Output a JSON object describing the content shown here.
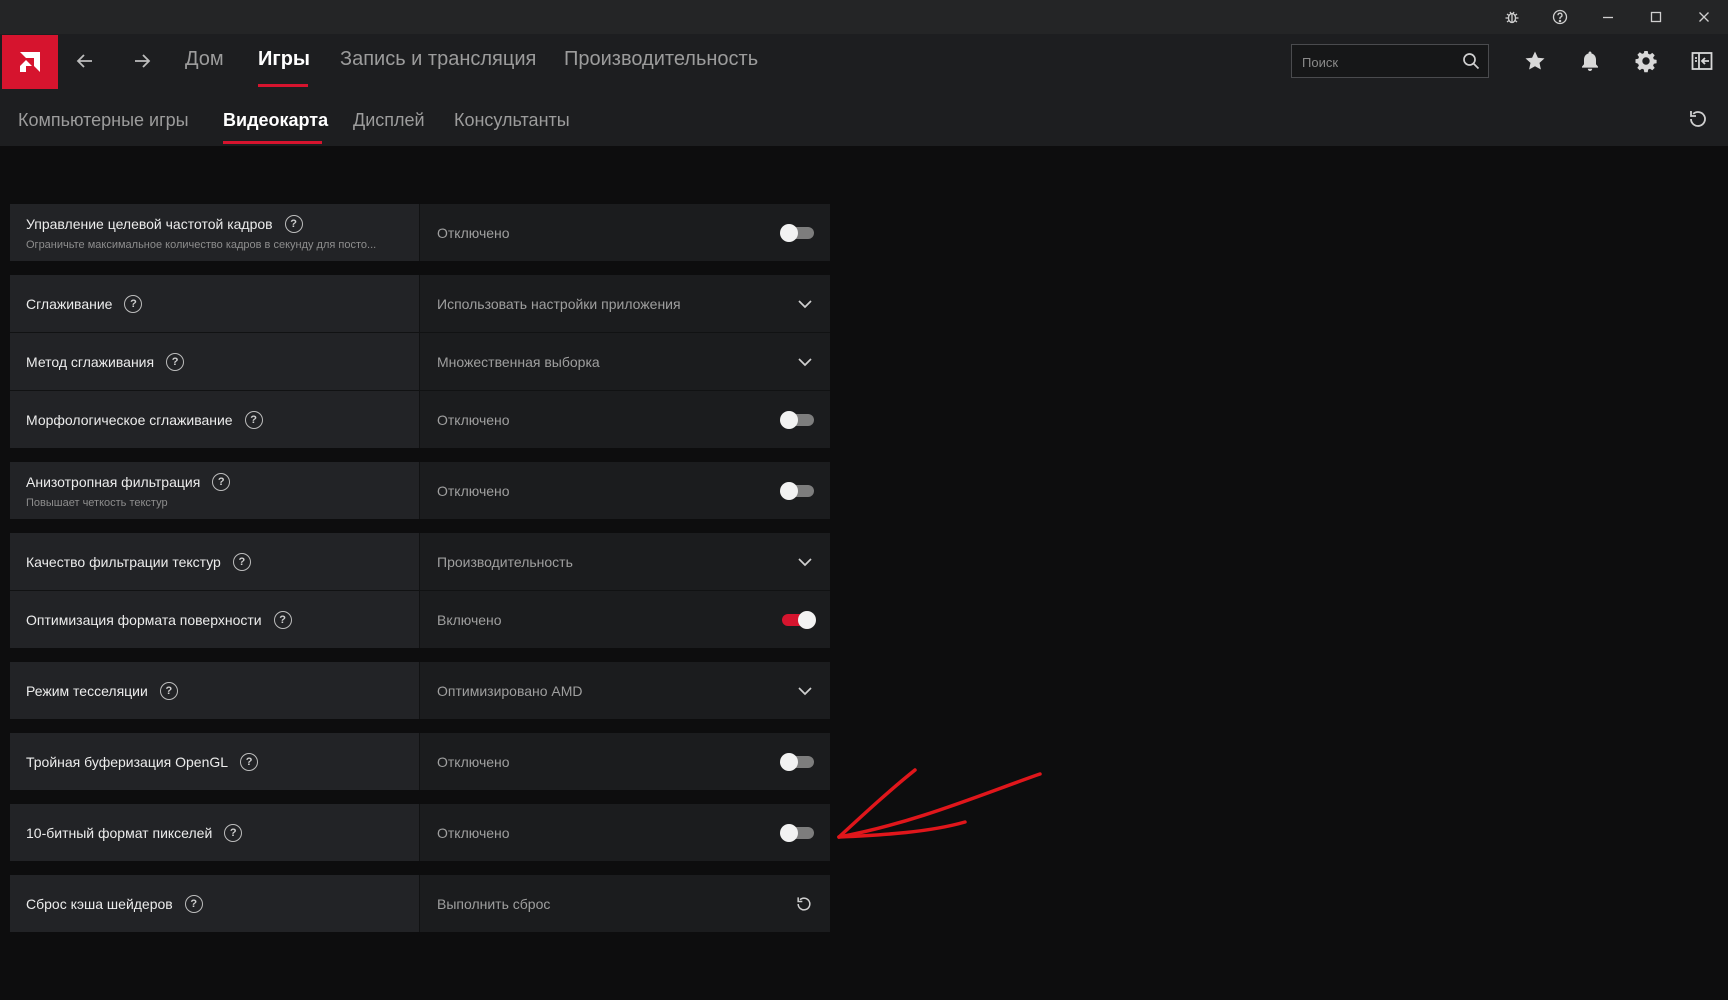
{
  "window": {
    "buttons": [
      "bug-report-icon",
      "help-icon",
      "minimize-icon",
      "maximize-icon",
      "close-icon"
    ]
  },
  "nav": {
    "tabs": [
      {
        "label": "Дом",
        "active": false
      },
      {
        "label": "Игры",
        "active": true
      },
      {
        "label": "Запись и трансляция",
        "active": false
      },
      {
        "label": "Производительность",
        "active": false
      }
    ],
    "search_placeholder": "Поиск",
    "icons": [
      "star-icon",
      "bell-icon",
      "gear-icon",
      "layout-icon"
    ]
  },
  "subnav": {
    "tabs": [
      {
        "label": "Компьютерные игры",
        "active": false
      },
      {
        "label": "Видеокарта",
        "active": true
      },
      {
        "label": "Дисплей",
        "active": false
      },
      {
        "label": "Консультанты",
        "active": false
      }
    ]
  },
  "settings": [
    {
      "name": "Управление целевой частотой кадров",
      "desc": "Ограничьте максимальное количество кадров в секунду для посто...",
      "value": "Отключено",
      "control": "toggle",
      "on": false
    },
    {
      "name": "Сглаживание",
      "value": "Использовать настройки приложения",
      "control": "dropdown"
    },
    {
      "name": "Метод сглаживания",
      "value": "Множественная выборка",
      "control": "dropdown"
    },
    {
      "name": "Морфологическое сглаживание",
      "value": "Отключено",
      "control": "toggle",
      "on": false
    },
    {
      "name": "Анизотропная фильтрация",
      "desc": "Повышает четкость текстур",
      "value": "Отключено",
      "control": "toggle",
      "on": false
    },
    {
      "name": "Качество фильтрации текстур",
      "value": "Производительность",
      "control": "dropdown"
    },
    {
      "name": "Оптимизация формата поверхности",
      "value": "Включено",
      "control": "toggle",
      "on": true
    },
    {
      "name": "Режим тесселяции",
      "value": "Оптимизировано AMD",
      "control": "dropdown"
    },
    {
      "name": "Тройная буферизация OpenGL",
      "value": "Отключено",
      "control": "toggle",
      "on": false
    },
    {
      "name": "10-битный формат пикселей",
      "value": "Отключено",
      "control": "toggle",
      "on": false
    },
    {
      "name": "Сброс кэша шейдеров",
      "value": "Выполнить сброс",
      "control": "reset"
    }
  ],
  "accent_color": "#d6142e",
  "annotation_color": "#e0161b"
}
